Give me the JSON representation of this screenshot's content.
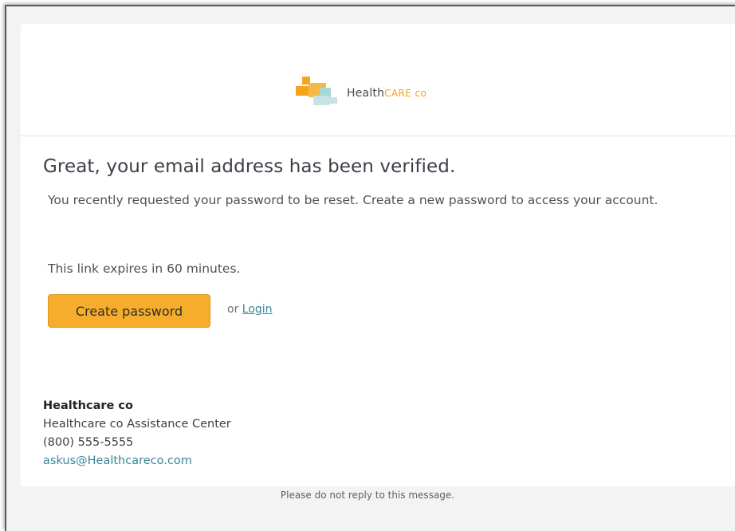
{
  "brand": {
    "name_main": "Health",
    "name_accent": "CARE co",
    "colors": {
      "accent": "#f5a41d",
      "teal": "#9fcfcf",
      "link": "#3a8596"
    }
  },
  "message": {
    "headline": "Great, your email address has been verified.",
    "body": "You recently requested your password to be reset. Create a new password to access your account.",
    "expiry": "This link expires in 60 minutes."
  },
  "actions": {
    "create_password_label": "Create password",
    "or_text": "or ",
    "login_label": "Login"
  },
  "footer": {
    "company": "Healthcare co",
    "center": "Healthcare co Assistance Center",
    "phone": "(800) 555-5555",
    "email": "askus@Healthcareco.com"
  },
  "note": "Please do not reply to this message."
}
